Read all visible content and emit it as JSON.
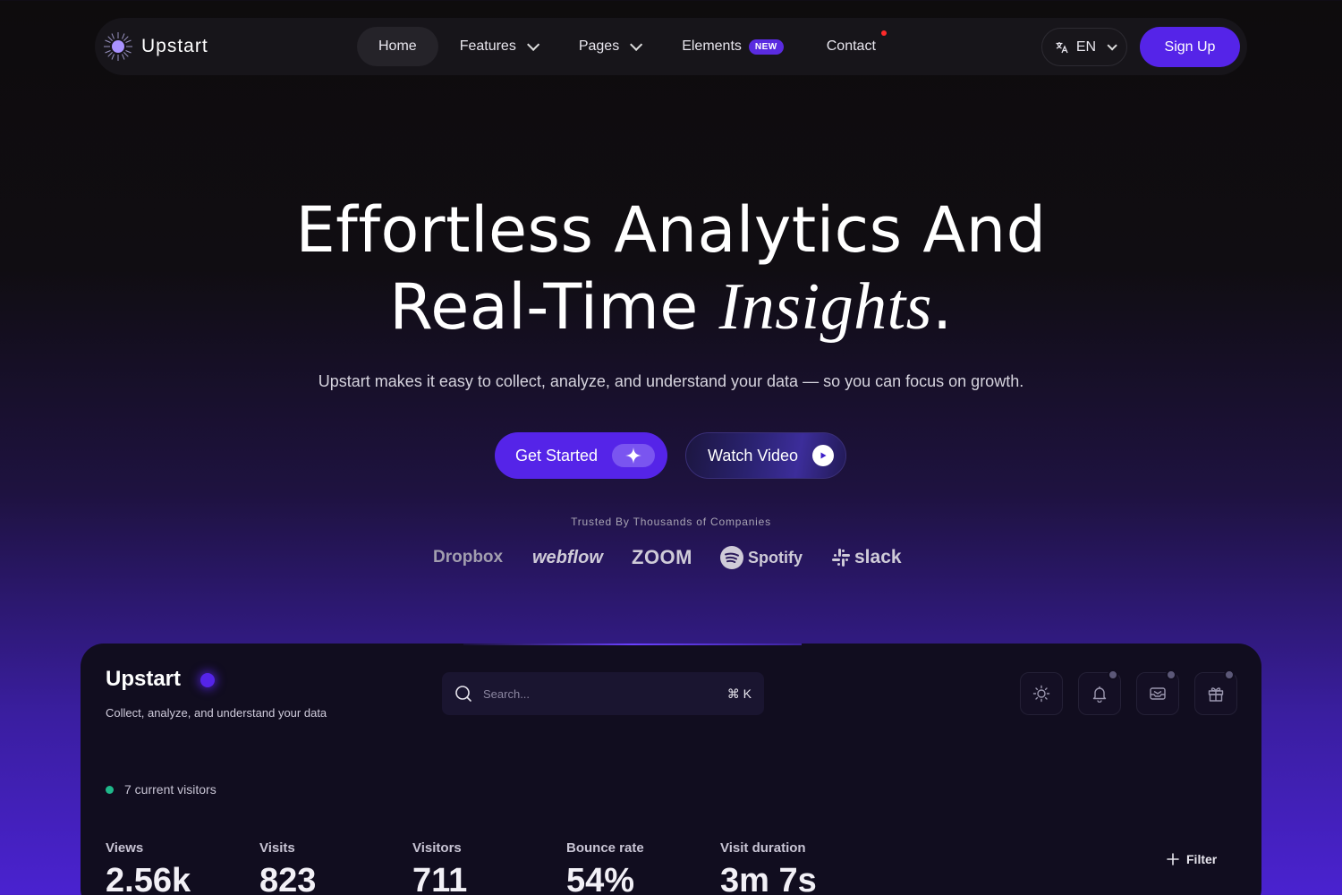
{
  "nav": {
    "brand": "Upstart",
    "items": [
      {
        "label": "Home"
      },
      {
        "label": "Features"
      },
      {
        "label": "Pages"
      },
      {
        "label": "Elements",
        "badge": "NEW"
      },
      {
        "label": "Contact"
      }
    ],
    "language": "EN",
    "signup_label": "Sign Up",
    "accent": "#5524e8"
  },
  "hero": {
    "title_line1": "Effortless Analytics And",
    "title_line2_a": "Real-Time ",
    "title_line2_b": "Insights",
    "title_line2_c": ".",
    "subtitle": "Upstart makes it easy to collect, analyze, and understand your data — so you can focus on growth.",
    "cta_primary": "Get Started",
    "cta_secondary": "Watch Video"
  },
  "trusted": {
    "label": "Trusted By Thousands of Companies",
    "logos": [
      "Dropbox",
      "webflow",
      "zoom",
      "Spotify",
      "slack"
    ]
  },
  "dashboard": {
    "brand": "Upstart",
    "tagline": "Collect, analyze, and understand your data",
    "search_placeholder": "Search...",
    "search_shortcut": "⌘ K",
    "current_visitors": "7 current visitors",
    "stats": [
      {
        "label": "Views",
        "value": "2.56k"
      },
      {
        "label": "Visits",
        "value": "823"
      },
      {
        "label": "Visitors",
        "value": "711"
      },
      {
        "label": "Bounce rate",
        "value": "54%"
      },
      {
        "label": "Visit duration",
        "value": "3m 7s"
      }
    ],
    "filter_label": "Filter"
  }
}
